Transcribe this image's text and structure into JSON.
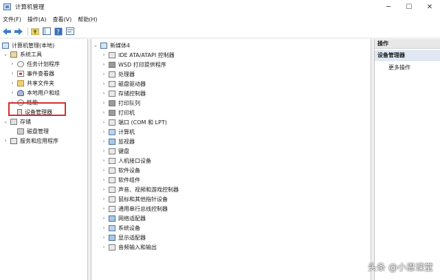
{
  "window": {
    "title": "计算机管理"
  },
  "menu": [
    "文件(F)",
    "操作(A)",
    "查看(V)",
    "帮助(H)"
  ],
  "tree": {
    "root": "计算机管理(本地)",
    "system_tools": "系统工具",
    "system_children": [
      "任务计划程序",
      "事件查看器",
      "共享文件夹",
      "本地用户和组",
      "性能",
      "设备管理器"
    ],
    "storage": "存储",
    "storage_children": [
      "磁盘管理"
    ],
    "services": "服务和应用程序"
  },
  "devices": {
    "computer_name": "新媒体4",
    "items": [
      "IDE ATA/ATAPI 控制器",
      "WSD 打印提供程序",
      "处理器",
      "磁盘驱动器",
      "存储控制器",
      "打印队列",
      "打印机",
      "端口 (COM 和 LPT)",
      "计算机",
      "监视器",
      "键盘",
      "人机接口设备",
      "软件设备",
      "软件组件",
      "声音、视频和游戏控制器",
      "鼠标和其他指针设备",
      "通用串行总线控制器",
      "网络适配器",
      "系统设备",
      "显示适配器",
      "音频输入和输出"
    ]
  },
  "actions": {
    "header": "操作",
    "section": "设备管理器",
    "more": "更多操作"
  },
  "watermark": "头条 @小恩课堂",
  "colors": {
    "highlight": "#d52a2a",
    "pane_border": "#c5c5c5"
  }
}
